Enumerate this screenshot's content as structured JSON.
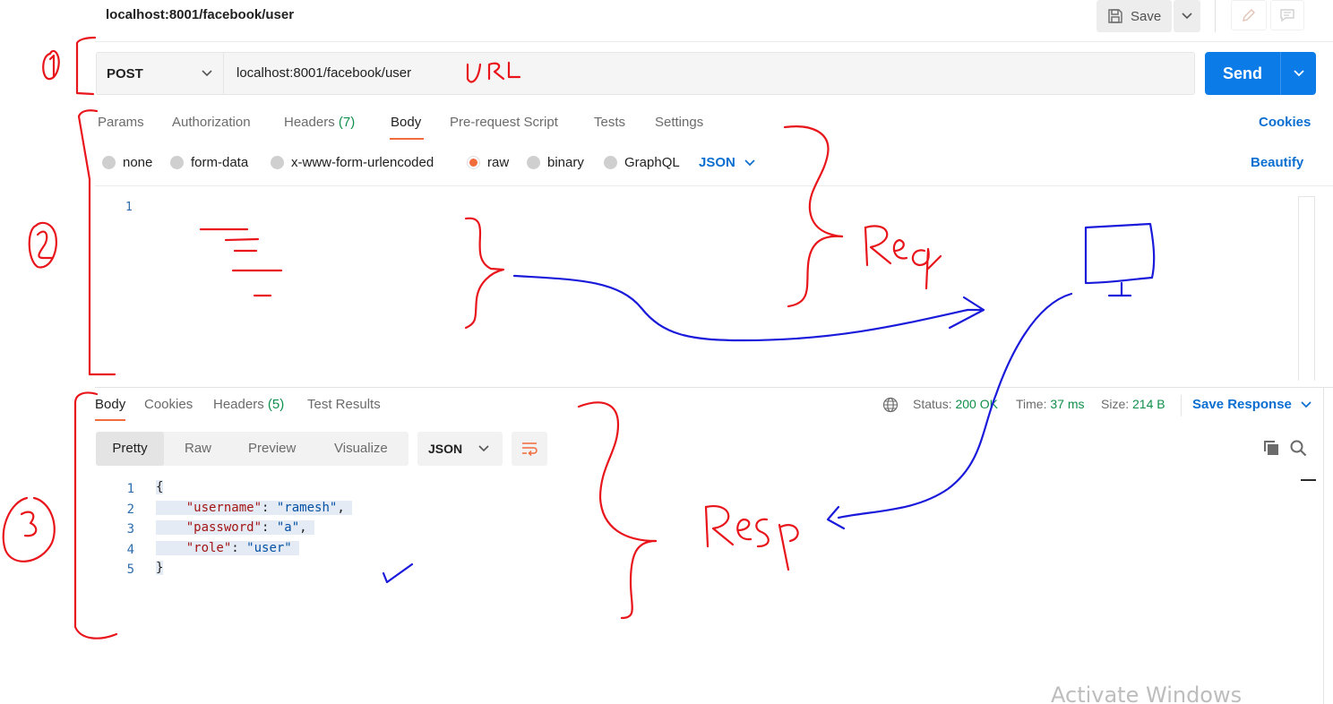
{
  "header": {
    "title": "localhost:8001/facebook/user",
    "save_label": "Save"
  },
  "request": {
    "method": "POST",
    "url": "localhost:8001/facebook/user",
    "send_label": "Send",
    "tabs": [
      {
        "label": "Params"
      },
      {
        "label": "Authorization"
      },
      {
        "label": "Headers",
        "count": "(7)"
      },
      {
        "label": "Body"
      },
      {
        "label": "Pre-request Script"
      },
      {
        "label": "Tests"
      },
      {
        "label": "Settings"
      }
    ],
    "active_tab": "Body",
    "cookies_label": "Cookies",
    "body_types": [
      "none",
      "form-data",
      "x-www-form-urlencoded",
      "raw",
      "binary",
      "GraphQL"
    ],
    "selected_body_type": "raw",
    "raw_format": "JSON",
    "beautify_label": "Beautify",
    "editor_line_numbers": [
      "1"
    ]
  },
  "response": {
    "tabs": [
      {
        "label": "Body"
      },
      {
        "label": "Cookies"
      },
      {
        "label": "Headers",
        "count": "(5)"
      },
      {
        "label": "Test Results"
      }
    ],
    "active_tab": "Body",
    "status_label": "Status:",
    "status_value": "200 OK",
    "time_label": "Time:",
    "time_value": "37 ms",
    "size_label": "Size:",
    "size_value": "214 B",
    "save_response_label": "Save Response",
    "views": [
      "Pretty",
      "Raw",
      "Preview",
      "Visualize"
    ],
    "active_view": "Pretty",
    "format": "JSON",
    "code_lines": [
      {
        "n": "1",
        "text": "{"
      },
      {
        "n": "2",
        "key": "\"username\"",
        "value": "\"ramesh\"",
        "tail": ","
      },
      {
        "n": "3",
        "key": "\"password\"",
        "value": "\"a\"",
        "tail": ","
      },
      {
        "n": "4",
        "key": "\"role\"",
        "value": "\"user\"",
        "tail": ""
      },
      {
        "n": "5",
        "text": "}"
      }
    ]
  },
  "annotations": {
    "marker_1": "1",
    "marker_2": "2",
    "marker_3": "3",
    "url_note": "URL",
    "req_note": "Req",
    "resp_note": "Resp",
    "ink_red": "#e8151b",
    "ink_blue": "#1a1adb"
  },
  "watermark": "Activate Windows",
  "colors": {
    "accent_blue": "#0b7be8",
    "link_blue": "#0b6fd1",
    "tab_underline": "#f26b3a",
    "status_green": "#0f8f4a"
  },
  "icons": [
    "save-icon",
    "chevron-down-icon",
    "edit-icon",
    "comment-icon",
    "globe-icon",
    "wrap-lines-icon",
    "copy-icon",
    "search-icon"
  ]
}
